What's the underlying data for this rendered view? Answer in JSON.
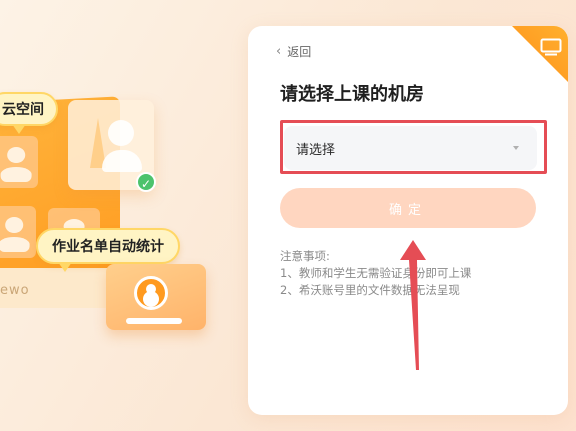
{
  "illustration": {
    "bubble_top": "云空间",
    "bubble_bottom": "作业名单自动统计",
    "strip_text": "ewo"
  },
  "panel": {
    "back_label": "返回",
    "title": "请选择上课的机房",
    "select": {
      "value": "请选择"
    },
    "confirm_label": "确定",
    "notes": {
      "heading": "注意事项:",
      "items": [
        "1、教师和学生无需验证身份即可上课",
        "2、希沃账号里的文件数据无法呈现"
      ]
    }
  },
  "colors": {
    "accent_orange": "#ff9a1f",
    "annotation_red": "#e54d55",
    "confirm_bg": "#ffd6c0"
  },
  "icons": {
    "back": "chevron-left-icon",
    "corner": "monitor-icon",
    "select": "caret-down-icon",
    "badge": "check-icon"
  }
}
